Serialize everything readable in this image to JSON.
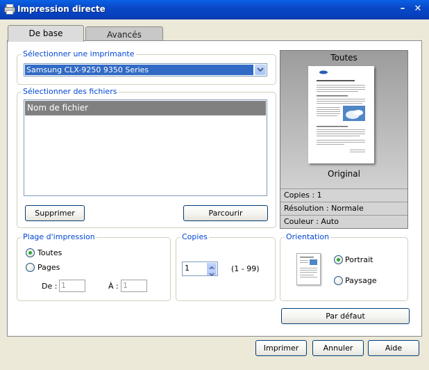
{
  "window": {
    "title": "Impression directe"
  },
  "tabs": [
    {
      "label": "De base"
    },
    {
      "label": "Avancés"
    }
  ],
  "printer_group": {
    "title": "Sélectionner une imprimante",
    "selected": "Samsung CLX-9250 9350 Series"
  },
  "files_group": {
    "title": "Sélectionner des fichiers",
    "column_header": "Nom de fichier",
    "delete_label": "Supprimer",
    "browse_label": "Parcourir"
  },
  "preview": {
    "title": "Toutes",
    "caption": "Original",
    "info": [
      "Copies : 1",
      "Résolution : Normale",
      "Couleur : Auto"
    ]
  },
  "range_group": {
    "title": "Plage d'impression",
    "all_label": "Toutes",
    "pages_label": "Pages",
    "from_label": "De :",
    "from_value": "1",
    "to_label": "À :",
    "to_value": "1"
  },
  "copies_group": {
    "title": "Copies",
    "value": "1",
    "range": "(1 - 99)"
  },
  "orientation_group": {
    "title": "Orientation",
    "portrait_label": "Portrait",
    "landscape_label": "Paysage"
  },
  "default_button": "Par défaut",
  "footer": {
    "print_label": "Imprimer",
    "cancel_label": "Annuler",
    "help_label": "Aide"
  },
  "colors": {
    "accent": "#0046d5",
    "selection": "#316ac5",
    "titlebar": "#0a4fd0"
  }
}
